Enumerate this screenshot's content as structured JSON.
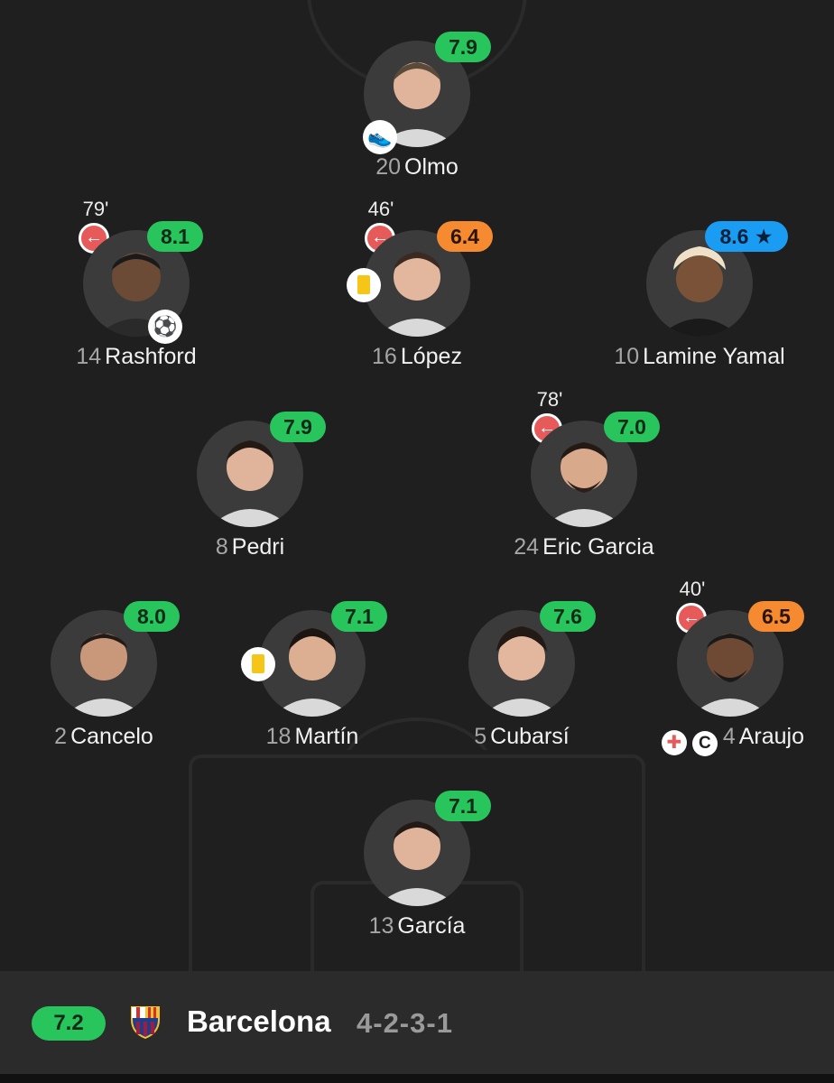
{
  "team": {
    "rating": "7.2",
    "name": "Barcelona",
    "formation": "4-2-3-1",
    "crest": "barcelona-crest"
  },
  "colors": {
    "rating_green": "#28c55c",
    "rating_orange": "#f58a31",
    "rating_blue": "#1b9cf3",
    "sub_red": "#e75a5a",
    "card_yellow": "#f5c518",
    "background": "#1f1f1f"
  },
  "players": {
    "olmo": {
      "number": "20",
      "name": "Olmo",
      "rating": "7.9",
      "event_icon": "boot-icon"
    },
    "rashford": {
      "number": "14",
      "name": "Rashford",
      "rating": "8.1",
      "sub_time": "79'",
      "event_icon": "ball-icon"
    },
    "lopez": {
      "number": "16",
      "name": "López",
      "rating": "6.4",
      "sub_time": "46'"
    },
    "yamal": {
      "number": "10",
      "name": "Lamine Yamal",
      "rating": "8.6",
      "rating_icon": "★"
    },
    "pedri": {
      "number": "8",
      "name": "Pedri",
      "rating": "7.9"
    },
    "ericgarcia": {
      "number": "24",
      "name": "Eric Garcia",
      "rating": "7.0",
      "sub_time": "78'"
    },
    "cancelo": {
      "number": "2",
      "name": "Cancelo",
      "rating": "8.0"
    },
    "martin": {
      "number": "18",
      "name": "Martín",
      "rating": "7.1"
    },
    "cubarsi": {
      "number": "5",
      "name": "Cubarsí",
      "rating": "7.6"
    },
    "araujo": {
      "number": "4",
      "name": "Araujo",
      "rating": "6.5",
      "sub_time": "40'",
      "captain_mark": "C"
    },
    "garcia": {
      "number": "13",
      "name": "García",
      "rating": "7.1"
    }
  },
  "icons": {
    "sub_arrow": "←",
    "injury": "✚"
  }
}
